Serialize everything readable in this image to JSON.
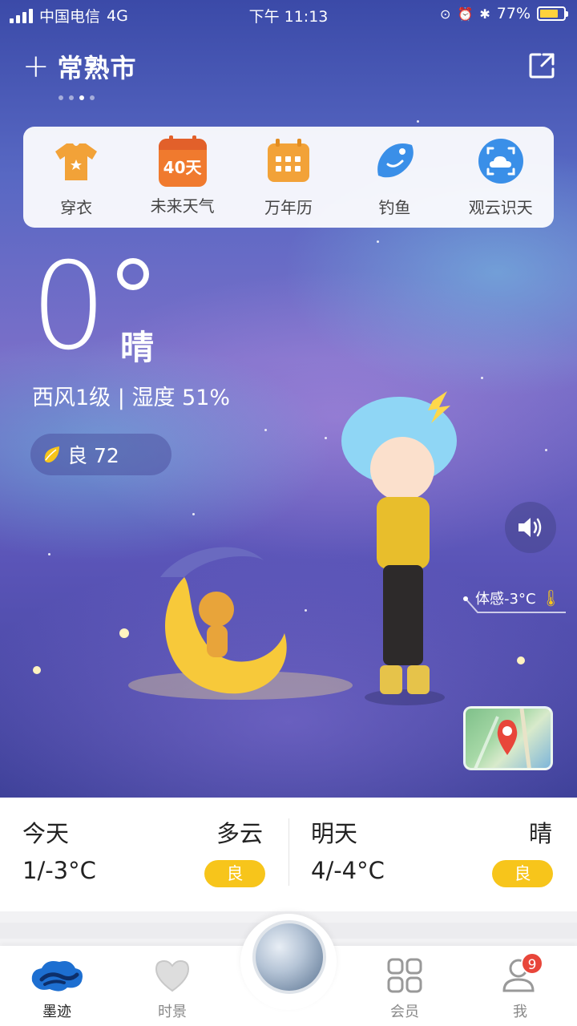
{
  "status_bar": {
    "carrier": "中国电信",
    "network": "4G",
    "time": "下午 11:13",
    "battery": "77%",
    "battery_level": 0.77
  },
  "header": {
    "add_symbol": "+",
    "city": "常熟市",
    "page_dots": 4,
    "active_dot": 3
  },
  "tools": [
    {
      "label": "穿衣",
      "icon": "shirt-icon"
    },
    {
      "label": "未来天气",
      "icon": "calendar-40-icon",
      "icon_text": "40天"
    },
    {
      "label": "万年历",
      "icon": "calendar-grid-icon"
    },
    {
      "label": "钓鱼",
      "icon": "fish-icon"
    },
    {
      "label": "观云识天",
      "icon": "cloud-scan-icon"
    }
  ],
  "current": {
    "temperature": "0",
    "condition": "晴",
    "wind_humidity": "西风1级 | 湿度 51%",
    "aqi": "良 72",
    "feels_like": "体感-3°C"
  },
  "forecast": {
    "today": {
      "day": "今天",
      "condition": "多云",
      "range": "1/-3°C",
      "aqi": "良"
    },
    "tomorrow": {
      "day": "明天",
      "condition": "晴",
      "range": "4/-4°C",
      "aqi": "良"
    }
  },
  "tabbar": {
    "tabs": [
      {
        "label": "墨迹",
        "icon": "moji-logo-icon"
      },
      {
        "label": "时景",
        "icon": "heart-icon"
      },
      {
        "label": "会员",
        "icon": "grid-icon"
      },
      {
        "label": "我",
        "icon": "user-icon"
      }
    ],
    "badge_count": "9"
  },
  "colors": {
    "accent_yellow": "#f7c51b",
    "badge_red": "#e8463a",
    "tool_orange": "#f2a238",
    "tool_blue": "#3a8fe8"
  }
}
